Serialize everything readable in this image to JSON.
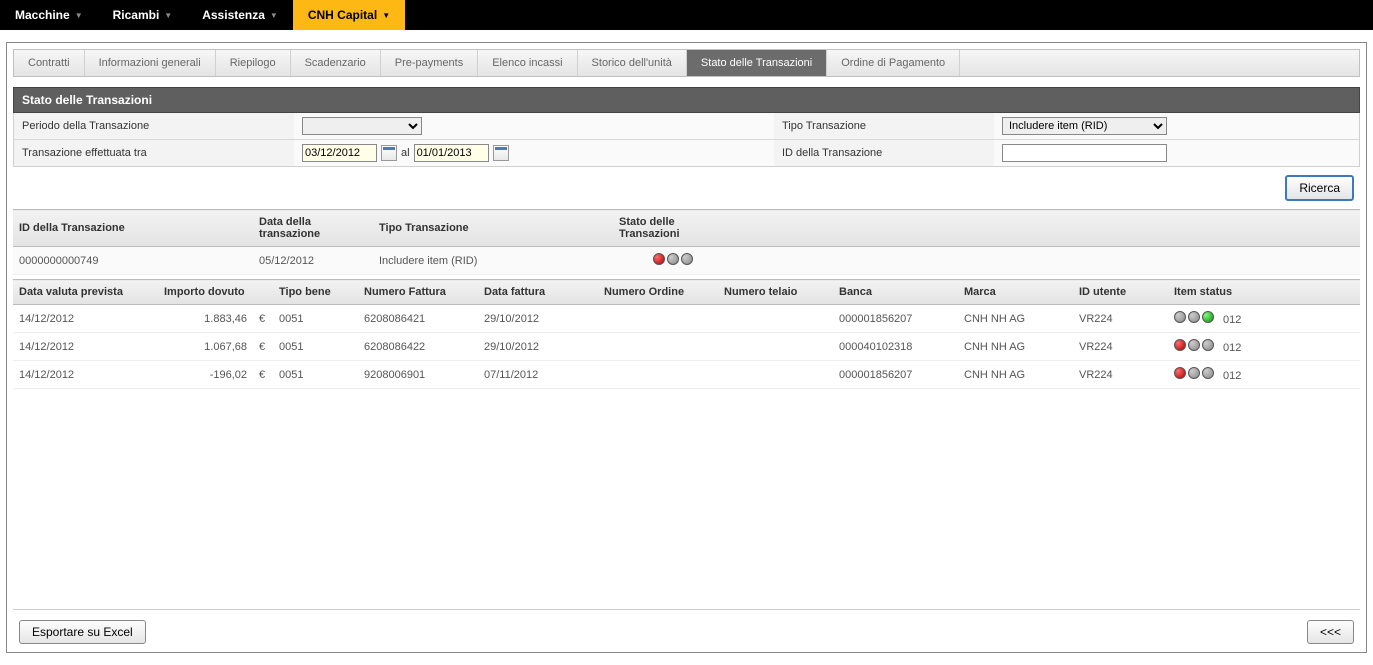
{
  "topnav": {
    "items": [
      {
        "label": "Macchine",
        "active": false
      },
      {
        "label": "Ricambi",
        "active": false
      },
      {
        "label": "Assistenza",
        "active": false
      },
      {
        "label": "CNH Capital",
        "active": true
      }
    ]
  },
  "subtabs": {
    "items": [
      {
        "label": "Contratti"
      },
      {
        "label": "Informazioni generali"
      },
      {
        "label": "Riepilogo"
      },
      {
        "label": "Scadenzario"
      },
      {
        "label": "Pre-payments"
      },
      {
        "label": "Elenco incassi"
      },
      {
        "label": "Storico dell'unità"
      },
      {
        "label": "Stato delle Transazioni"
      },
      {
        "label": "Ordine di Pagamento"
      }
    ],
    "active_index": 7
  },
  "section_title": "Stato delle Transazioni",
  "filters": {
    "periodo_label": "Periodo della Transazione",
    "periodo_value": "",
    "tipo_label": "Tipo Transazione",
    "tipo_value": "Includere item (RID)",
    "tra_label": "Transazione effettuata tra",
    "date_from": "03/12/2012",
    "date_sep": "al",
    "date_to": "01/01/2013",
    "idtrans_label": "ID della Transazione",
    "idtrans_value": ""
  },
  "buttons": {
    "search": "Ricerca",
    "export": "Esportare su Excel",
    "back": "<<<"
  },
  "tbl1": {
    "headers": {
      "id": "ID della Transazione",
      "data": "Data della transazione",
      "tipo": "Tipo Transazione",
      "stato": "Stato delle Transazioni"
    },
    "row": {
      "id": "0000000000749",
      "data": "05/12/2012",
      "tipo": "Includere item (RID)"
    }
  },
  "tbl2": {
    "headers": {
      "data_valuta": "Data valuta prevista",
      "importo": "Importo dovuto",
      "tipo_bene": "Tipo bene",
      "num_fattura": "Numero Fattura",
      "data_fattura": "Data fattura",
      "num_ordine": "Numero Ordine",
      "num_telaio": "Numero telaio",
      "banca": "Banca",
      "marca": "Marca",
      "id_utente": "ID utente",
      "item_status": "Item status"
    },
    "rows": [
      {
        "data_valuta": "14/12/2012",
        "importo": "1.883,46",
        "cur": "€",
        "tipo_bene": "0051",
        "num_fattura": "6208086421",
        "data_fattura": "29/10/2012",
        "num_ordine": "",
        "num_telaio": "",
        "banca": "000001856207",
        "marca": "CNH NH AG",
        "id_utente": "VR224",
        "status": "green",
        "code": "012"
      },
      {
        "data_valuta": "14/12/2012",
        "importo": "1.067,68",
        "cur": "€",
        "tipo_bene": "0051",
        "num_fattura": "6208086422",
        "data_fattura": "29/10/2012",
        "num_ordine": "",
        "num_telaio": "",
        "banca": "000040102318",
        "marca": "CNH NH AG",
        "id_utente": "VR224",
        "status": "red",
        "code": "012"
      },
      {
        "data_valuta": "14/12/2012",
        "importo": "-196,02",
        "cur": "€",
        "tipo_bene": "0051",
        "num_fattura": "9208006901",
        "data_fattura": "07/11/2012",
        "num_ordine": "",
        "num_telaio": "",
        "banca": "000001856207",
        "marca": "CNH NH AG",
        "id_utente": "VR224",
        "status": "red",
        "code": "012"
      }
    ]
  }
}
